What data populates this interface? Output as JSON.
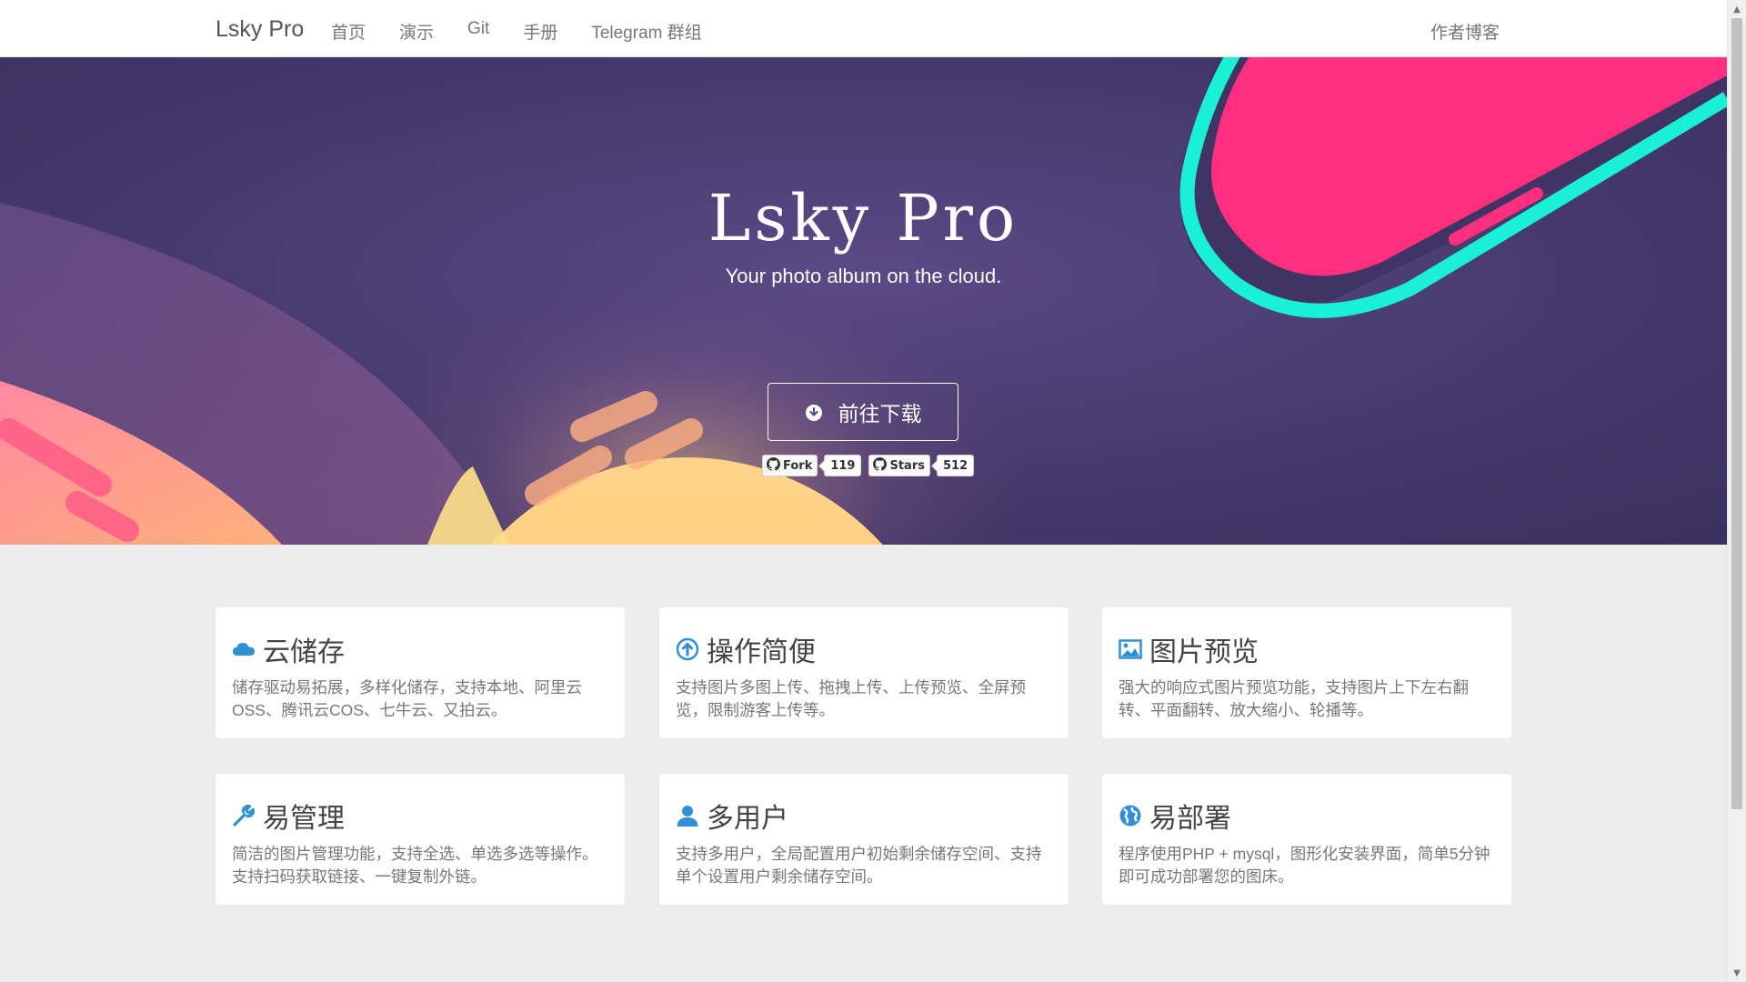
{
  "navbar": {
    "brand": "Lsky Pro",
    "links": [
      "首页",
      "演示",
      "Git",
      "手册",
      "Telegram 群组"
    ],
    "right_link": "作者博客"
  },
  "hero": {
    "title": "Lsky Pro",
    "subtitle": "Your photo album on the cloud.",
    "download_button": "前往下载",
    "badges": {
      "fork": {
        "label": "Fork",
        "count": "119"
      },
      "stars": {
        "label": "Stars",
        "count": "512"
      }
    }
  },
  "features": [
    {
      "icon": "cloud-icon",
      "title": "云储存",
      "desc": "储存驱动易拓展，多样化储存，支持本地、阿里云OSS、腾讯云COS、七牛云、又拍云。"
    },
    {
      "icon": "upload-circle-icon",
      "title": "操作简便",
      "desc": "支持图片多图上传、拖拽上传、上传预览、全屏预览，限制游客上传等。"
    },
    {
      "icon": "image-icon",
      "title": "图片预览",
      "desc": "强大的响应式图片预览功能，支持图片上下左右翻转、平面翻转、放大缩小、轮播等。"
    },
    {
      "icon": "wrench-icon",
      "title": "易管理",
      "desc": "简洁的图片管理功能，支持全选、单选多选等操作。支持扫码获取链接、一键复制外链。"
    },
    {
      "icon": "user-icon",
      "title": "多用户",
      "desc": "支持多用户，全局配置用户初始剩余储存空间、支持单个设置用户剩余储存空间。"
    },
    {
      "icon": "globe-icon",
      "title": "易部署",
      "desc": "程序使用PHP + mysql，图形化安装界面，简单5分钟即可成功部署您的图床。"
    }
  ],
  "colors": {
    "hero_bg": "#4a3b70",
    "accent_blue": "#2f8fd8",
    "comet_pink": "#ff2e7e",
    "comet_teal": "#19f0d6",
    "sun_yellow": "#ffc97a"
  }
}
